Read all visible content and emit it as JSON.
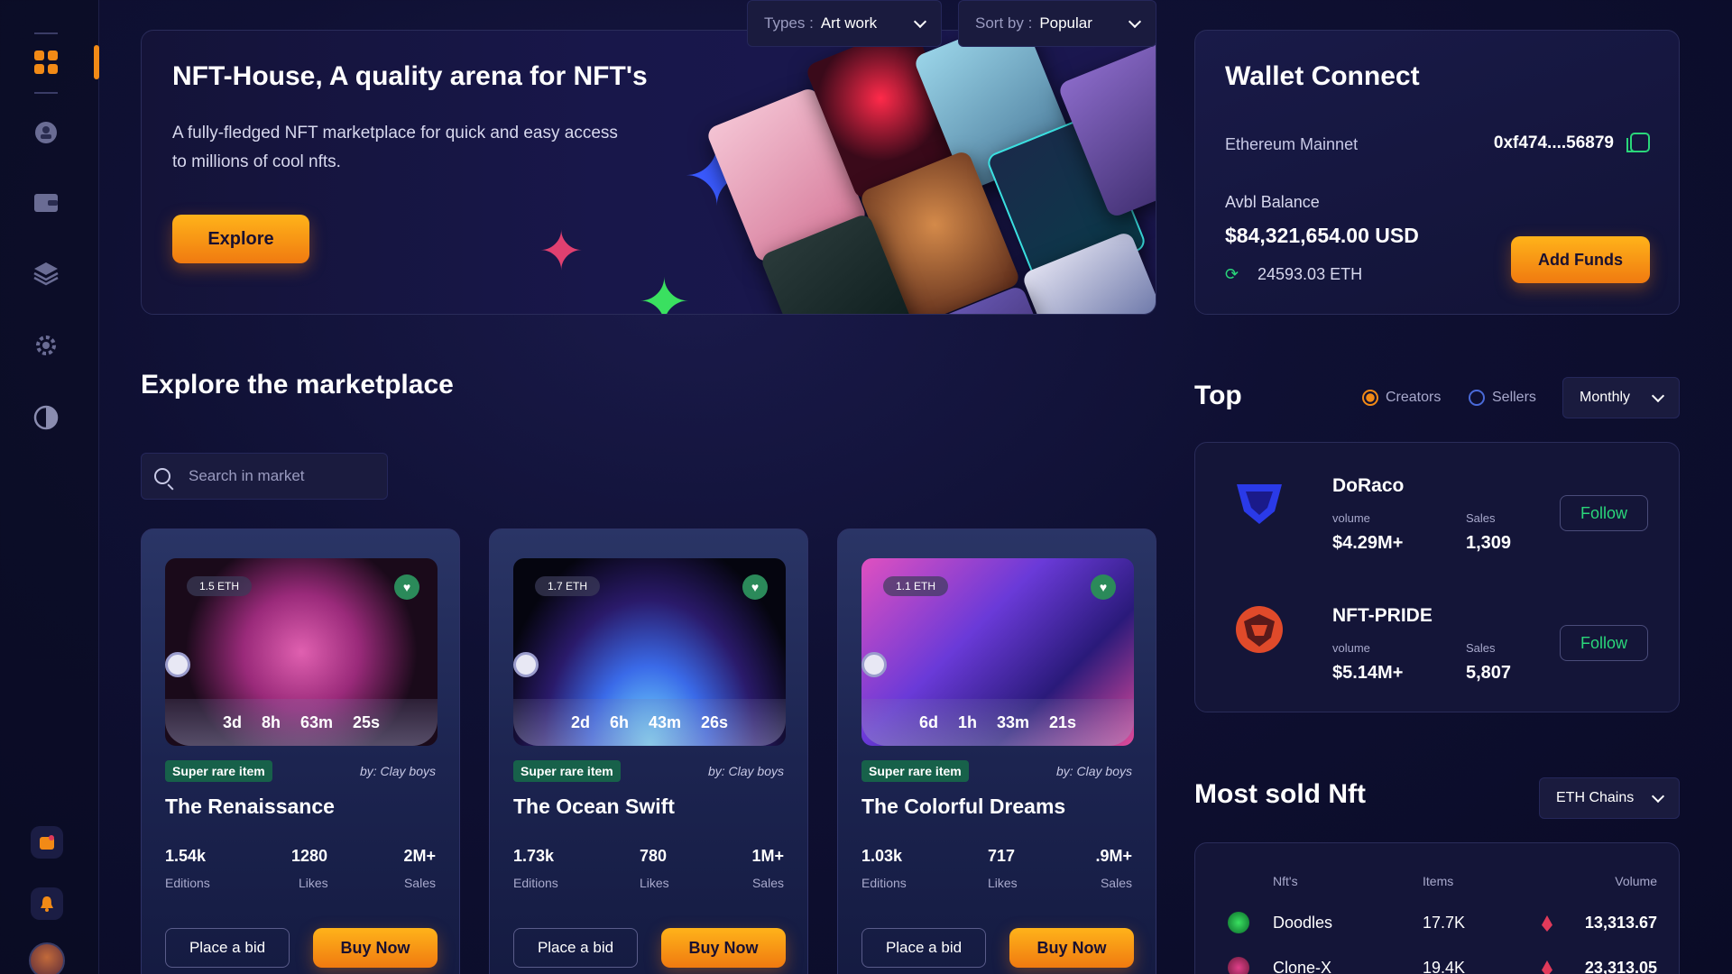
{
  "hero": {
    "title": "NFT-House, A quality arena for NFT's",
    "description": "A fully-fledged NFT marketplace for quick and easy access to millions of cool nfts.",
    "explore_label": "Explore"
  },
  "wallet": {
    "title": "Wallet Connect",
    "network": "Ethereum Mainnet",
    "address": "0xf474....56879",
    "balance_label": "Avbl Balance",
    "balance_usd": "$84,321,654.00 USD",
    "balance_eth": "24593.03 ETH",
    "add_funds_label": "Add Funds"
  },
  "explore": {
    "title": "Explore the marketplace",
    "search_placeholder": "Search in market",
    "type_label": "Types :",
    "type_value": "Art work",
    "sort_label": "Sort by :",
    "sort_value": "Popular"
  },
  "cards": [
    {
      "price": "1.5 ETH",
      "timer": [
        "3d",
        "8h",
        "63m",
        "25s"
      ],
      "badge": "Super rare item",
      "by": "by: Clay boys",
      "title": "The Renaissance",
      "stats": [
        {
          "value": "1.54k",
          "label": "Editions"
        },
        {
          "value": "1280",
          "label": "Likes"
        },
        {
          "value": "2M+",
          "label": "Sales"
        }
      ],
      "bid_label": "Place a bid",
      "buy_label": "Buy Now"
    },
    {
      "price": "1.7 ETH",
      "timer": [
        "2d",
        "6h",
        "43m",
        "26s"
      ],
      "badge": "Super rare item",
      "by": "by: Clay boys",
      "title": "The Ocean Swift",
      "stats": [
        {
          "value": "1.73k",
          "label": "Editions"
        },
        {
          "value": "780",
          "label": "Likes"
        },
        {
          "value": "1M+",
          "label": "Sales"
        }
      ],
      "bid_label": "Place a bid",
      "buy_label": "Buy Now"
    },
    {
      "price": "1.1 ETH",
      "timer": [
        "6d",
        "1h",
        "33m",
        "21s"
      ],
      "badge": "Super rare item",
      "by": "by: Clay boys",
      "title": "The Colorful Dreams",
      "stats": [
        {
          "value": "1.03k",
          "label": "Editions"
        },
        {
          "value": "717",
          "label": "Likes"
        },
        {
          "value": ".9M+",
          "label": "Sales"
        }
      ],
      "bid_label": "Place a bid",
      "buy_label": "Buy Now"
    }
  ],
  "top": {
    "title": "Top",
    "filter_creators": "Creators",
    "filter_sellers": "Sellers",
    "period": "Monthly",
    "creators": [
      {
        "name": "DoRaco",
        "volume_label": "volume",
        "volume": "$4.29M+",
        "sales_label": "Sales",
        "sales": "1,309",
        "follow_label": "Follow"
      },
      {
        "name": "NFT-PRIDE",
        "volume_label": "volume",
        "volume": "$5.14M+",
        "sales_label": "Sales",
        "sales": "5,807",
        "follow_label": "Follow"
      }
    ]
  },
  "most_sold": {
    "title": "Most sold Nft",
    "chain": "ETH Chains",
    "headers": [
      "Nft's",
      "Items",
      "Volume"
    ],
    "rows": [
      {
        "name": "Doodles",
        "items": "17.7K",
        "volume": "13,313.67"
      },
      {
        "name": "Clone-X",
        "items": "19.4K",
        "volume": "23,313.05"
      }
    ]
  },
  "colors": {
    "accent": "#f28a16",
    "success": "#2ad67a",
    "background": "#0f1033"
  }
}
